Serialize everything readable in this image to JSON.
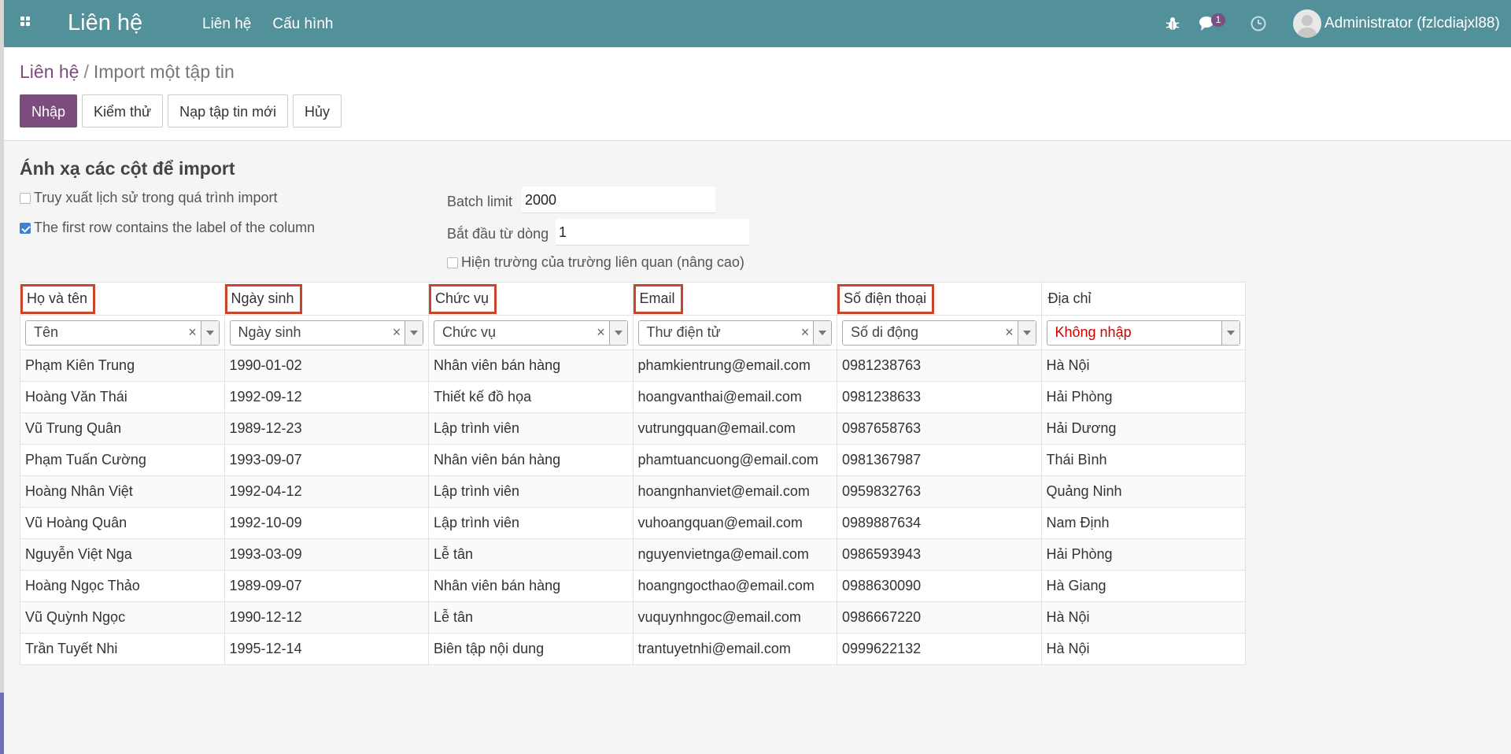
{
  "navbar": {
    "brand": "Liên hệ",
    "menu": [
      "Liên hệ",
      "Cấu hình"
    ],
    "chat_count": "1",
    "user": "Administrator (fzlcdiajxl88)",
    "icons": [
      "apps-icon",
      "bug-icon",
      "chat-icon",
      "clock-icon"
    ]
  },
  "breadcrumb": {
    "parent": "Liên hệ",
    "separator": "/",
    "current": "Import một tập tin"
  },
  "buttons": {
    "import": "Nhập",
    "test": "Kiểm thử",
    "reload": "Nạp tập tin mới",
    "cancel": "Hủy"
  },
  "options": {
    "title": "Ánh xạ các cột để import",
    "track_history": "Truy xuất lịch sử trong quá trình import",
    "track_history_checked": false,
    "first_row_label": "The first row contains the label of the column",
    "first_row_label_checked": true,
    "batch_limit_label": "Batch limit",
    "batch_limit_value": "2000",
    "start_row_label": "Bắt đầu từ dòng",
    "start_row_value": "1",
    "show_relational": "Hiện trường của trường liên quan (nâng cao)",
    "show_relational_checked": false
  },
  "table": {
    "headers": [
      "Họ và tên",
      "Ngày sinh",
      "Chức vụ",
      "Email",
      "Số điện thoại",
      "Địa chỉ"
    ],
    "highlighted": [
      true,
      true,
      true,
      true,
      true,
      false
    ],
    "mappings": [
      "Tên",
      "Ngày sinh",
      "Chức vụ",
      "Thư điện tử",
      "Số di động",
      "Không nhập"
    ],
    "rows": [
      [
        "Phạm Kiên Trung",
        "1990-01-02",
        "Nhân viên bán hàng",
        "phamkientrung@email.com",
        "0981238763",
        "Hà Nội"
      ],
      [
        "Hoàng Văn Thái",
        "1992-09-12",
        "Thiết kế đồ họa",
        "hoangvanthai@email.com",
        "0981238633",
        "Hải Phòng"
      ],
      [
        "Vũ Trung Quân",
        "1989-12-23",
        "Lập trình viên",
        "vutrungquan@email.com",
        "0987658763",
        "Hải Dương"
      ],
      [
        "Phạm Tuấn Cường",
        "1993-09-07",
        "Nhân viên bán hàng",
        "phamtuancuong@email.com",
        "0981367987",
        "Thái Bình"
      ],
      [
        "Hoàng Nhân Việt",
        "1992-04-12",
        "Lập trình viên",
        "hoangnhanviet@email.com",
        "0959832763",
        "Quảng Ninh"
      ],
      [
        "Vũ Hoàng Quân",
        "1992-10-09",
        "Lập trình viên",
        "vuhoangquan@email.com",
        "0989887634",
        "Nam Định"
      ],
      [
        "Nguyễn Việt Nga",
        "1993-03-09",
        "Lễ tân",
        "nguyenvietnga@email.com",
        "0986593943",
        "Hải Phòng"
      ],
      [
        "Hoàng Ngọc Thảo",
        "1989-09-07",
        "Nhân viên bán hàng",
        "hoangngocthao@email.com",
        "0988630090",
        "Hà Giang"
      ],
      [
        "Vũ Quỳnh Ngọc",
        "1990-12-12",
        "Lễ tân",
        "vuquynhngoc@email.com",
        "0986667220",
        "Hà Nội"
      ],
      [
        "Trần Tuyết Nhi",
        "1995-12-14",
        "Biên tập nội dung",
        "trantuyetnhi@email.com",
        "0999622132",
        "Hà Nội"
      ]
    ]
  },
  "colors": {
    "navbar": "#52919a",
    "primary": "#7c4c7e",
    "highlight_border": "#c9462c",
    "not_imported": "#cc0000"
  }
}
